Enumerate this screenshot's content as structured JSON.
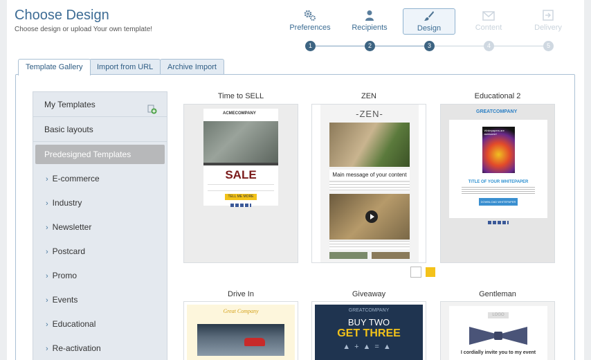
{
  "header": {
    "title": "Choose Design",
    "subtitle": "Choose design or upload Your own template!"
  },
  "wizard": {
    "steps": [
      {
        "label": "Preferences",
        "number": "1",
        "icon": "gears-icon",
        "state": "done"
      },
      {
        "label": "Recipients",
        "number": "2",
        "icon": "user-icon",
        "state": "done"
      },
      {
        "label": "Design",
        "number": "3",
        "icon": "brush-icon",
        "state": "active"
      },
      {
        "label": "Content",
        "number": "4",
        "icon": "envelope-icon",
        "state": "disabled"
      },
      {
        "label": "Delivery",
        "number": "5",
        "icon": "export-icon",
        "state": "disabled"
      }
    ]
  },
  "tabs": [
    {
      "label": "Template Gallery",
      "active": true
    },
    {
      "label": "Import from URL",
      "active": false
    },
    {
      "label": "Archive Import",
      "active": false
    }
  ],
  "sidebar": {
    "my_templates": "My Templates",
    "basic_layouts": "Basic layouts",
    "predesigned": "Predesigned Templates",
    "categories": [
      "E-commerce",
      "Industry",
      "Newsletter",
      "Postcard",
      "Promo",
      "Events",
      "Educational",
      "Re-activation"
    ]
  },
  "templates": {
    "row1": [
      {
        "name": "Time to SELL",
        "logo": "ACMECOMPANY",
        "headline": "SALE",
        "button": "TELL ME MORE"
      },
      {
        "name": "ZEN",
        "logo": "-ZEN-",
        "headline": "Main message of your content"
      },
      {
        "name": "Educational 2",
        "logo": "GREATCOMPANY",
        "cover": "Whitepapers are awesome!",
        "headline": "TITLE OF YOUR WHITEPAPER",
        "button": "DOWNLOAD WHITEPAPER"
      }
    ],
    "row2": [
      {
        "name": "Drive In",
        "logo": "Great Company"
      },
      {
        "name": "Giveaway",
        "logo": "GREATCOMPANY",
        "line1": "BUY TWO",
        "line2": "GET THREE"
      },
      {
        "name": "Gentleman",
        "logo": "LOGO",
        "headline": "I cordially invite you to my event"
      }
    ]
  },
  "colors": {
    "accent": "#3d6c95",
    "swatch_white": "#ffffff",
    "swatch_yellow": "#f4c21a"
  }
}
